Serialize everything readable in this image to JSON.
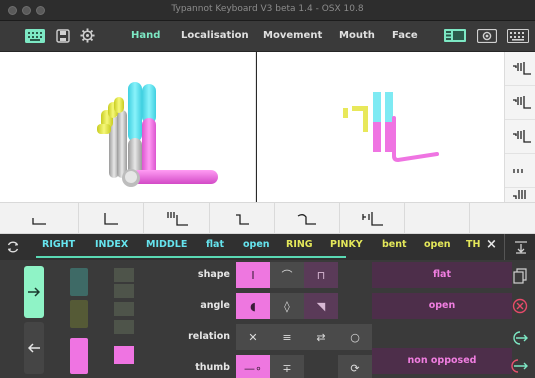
{
  "window": {
    "title": "Typannot Keyboard V3 beta 1.4 - OSX 10.8"
  },
  "toolbar": {
    "icons": [
      "keyboard-icon",
      "save-icon",
      "gear-icon"
    ],
    "nav": [
      "Hand",
      "Localisation",
      "Movement",
      "Mouth",
      "Face"
    ],
    "active": "Hand",
    "right_icons": [
      "layout-toggle-icon",
      "camera-icon",
      "keyboard-mini-icon"
    ]
  },
  "tokens": {
    "items": [
      "RIGHT",
      "INDEX",
      "MIDDLE",
      "flat",
      "open",
      "RING",
      "PINKY",
      "bent",
      "open",
      "TH"
    ],
    "colors": [
      "blue",
      "blue",
      "blue",
      "blue",
      "blue",
      "yellow",
      "yellow",
      "yellow",
      "yellow",
      "yellow"
    ],
    "close_label": "×"
  },
  "panel": {
    "rows": [
      {
        "label": "shape",
        "value": "flat"
      },
      {
        "label": "angle",
        "value": "open"
      },
      {
        "label": "relation",
        "value": ""
      },
      {
        "label": "thumb",
        "value": "non opposed"
      }
    ]
  },
  "colors": {
    "accent": "#7de8c4",
    "magenta": "#ee77e0",
    "cyan": "#66e4ee",
    "yellow": "#e4e85a"
  }
}
